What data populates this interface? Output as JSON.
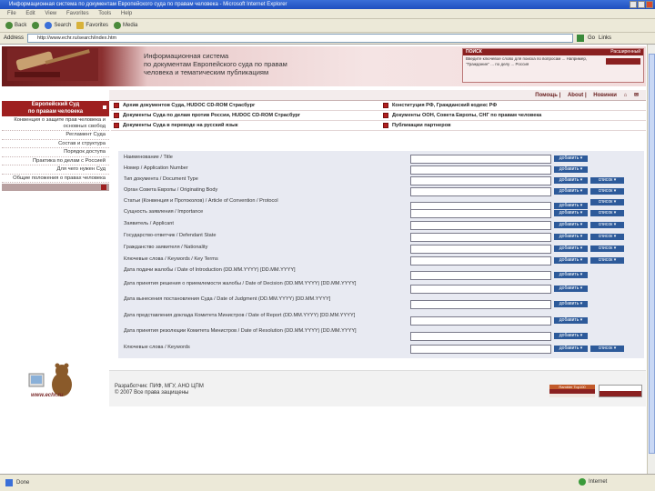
{
  "window": {
    "title": "Информационная система по документам Европейского суда по правам человека - Microsoft Internet Explorer",
    "menu": [
      "File",
      "Edit",
      "View",
      "Favorites",
      "Tools",
      "Help"
    ],
    "toolbar": [
      "Back",
      "Search",
      "Favorites",
      "Media"
    ]
  },
  "address": {
    "label": "Address",
    "url": "http://www.echr.ru/search/index.htm",
    "go": "Go",
    "links": "Links"
  },
  "header": {
    "title_line1": "Информационная система",
    "title_line2": "по документам Европейского суда по правам",
    "title_line3": "человека и тематическим публикациям",
    "search_title": "ПОИСК",
    "search_link": "Расширенный",
    "search_text": "Введите ключевое слово для поиска по вопросам ... Например, \"Гражданин\" ... по делу ... Россия"
  },
  "topnav": [
    "Помощь",
    "About",
    "Новинки"
  ],
  "sidebar": {
    "head_line1": "Европейский Суд",
    "head_line2": "по правам человека",
    "items": [
      "Конвенция о защите прав человека и основных свобод",
      "Регламент Суда",
      "Состав и структура",
      "Порядок доступа",
      "Практика по делам с Россией",
      "Для чего нужен Суд",
      "Общие положения о правах человека"
    ]
  },
  "checks": [
    "Архив документов Суда, HUDOC CD-ROM Страсбург",
    "Конституция РФ, Гражданский кодекс РФ",
    "Документы Суда по делам против России, HUDOC CD-ROM Страсбург",
    "Документы ООН, Совета Европы, СНГ по правам человека",
    "Документы Суда в переводе на русский язык",
    "Публикации партнеров"
  ],
  "form": {
    "add": "добавить ▾",
    "extra": "список ▾",
    "rows": [
      {
        "label": "Наименование / Title",
        "btns": 1
      },
      {
        "label": "Номер / Application Number",
        "btns": 1
      },
      {
        "label": "Тип документа / Document Type",
        "btns": 2
      },
      {
        "label": "Орган Совета Европы / Originating Body",
        "btns": 2
      },
      {
        "label": "Статьи (Конвенция и Протоколов) / Article of Convention / Protocol",
        "btns": 2
      },
      {
        "label": "Сущность заявления / Importance",
        "btns": 2
      },
      {
        "label": "Заявитель / Applicant",
        "btns": 2
      },
      {
        "label": "Государство-ответчик / Defendant State",
        "btns": 2
      },
      {
        "label": "Гражданство заявителя / Nationality",
        "btns": 2
      },
      {
        "label": "Ключевые слова / Keywords / Key Terms",
        "btns": 2
      },
      {
        "label": "Дата подачи жалобы / Date of Introduction (DD.MM.YYYY) [DD.MM.YYYY]",
        "btns": 1
      },
      {
        "label": "Дата принятия решения о приемлемости жалобы / Date of Decision (DD.MM.YYYY) [DD.MM.YYYY]",
        "btns": 1
      },
      {
        "label": "Дата вынесения постановления Суда / Date of Judgment (DD.MM.YYYY) [DD.MM.YYYY]",
        "btns": 1
      },
      {
        "label": "Дата представления доклада Комитета Министров / Date of Report (DD.MM.YYYY) [DD.MM.YYYY]",
        "btns": 1
      },
      {
        "label": "Дата принятия резолюции Комитета Министров / Date of Resolution (DD.MM.YYYY) [DD.MM.YYYY]",
        "btns": 1
      },
      {
        "label": "Ключевые слова / Keywords",
        "btns": 2
      }
    ]
  },
  "footer": {
    "line1": "Разработчик: ПИФ, МГУ, АНО ЦПМ",
    "line2": "© 2007 Все права защищены",
    "logo_text": "www.echr.ru",
    "badge1": "Rambler Top100"
  },
  "status": {
    "text": "Done",
    "zone": "Internet"
  }
}
